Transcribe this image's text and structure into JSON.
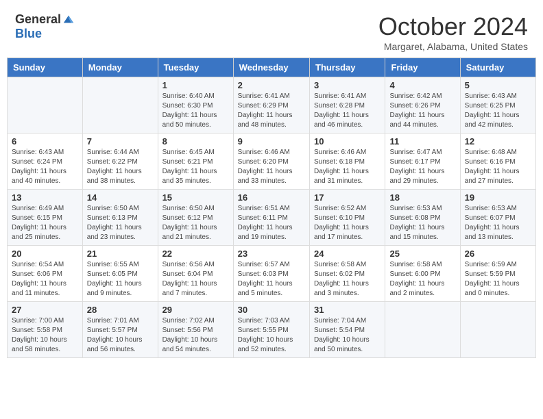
{
  "header": {
    "logo_general": "General",
    "logo_blue": "Blue",
    "title": "October 2024",
    "location": "Margaret, Alabama, United States"
  },
  "days_of_week": [
    "Sunday",
    "Monday",
    "Tuesday",
    "Wednesday",
    "Thursday",
    "Friday",
    "Saturday"
  ],
  "weeks": [
    [
      {
        "day": "",
        "info": ""
      },
      {
        "day": "",
        "info": ""
      },
      {
        "day": "1",
        "info": "Sunrise: 6:40 AM\nSunset: 6:30 PM\nDaylight: 11 hours and 50 minutes."
      },
      {
        "day": "2",
        "info": "Sunrise: 6:41 AM\nSunset: 6:29 PM\nDaylight: 11 hours and 48 minutes."
      },
      {
        "day": "3",
        "info": "Sunrise: 6:41 AM\nSunset: 6:28 PM\nDaylight: 11 hours and 46 minutes."
      },
      {
        "day": "4",
        "info": "Sunrise: 6:42 AM\nSunset: 6:26 PM\nDaylight: 11 hours and 44 minutes."
      },
      {
        "day": "5",
        "info": "Sunrise: 6:43 AM\nSunset: 6:25 PM\nDaylight: 11 hours and 42 minutes."
      }
    ],
    [
      {
        "day": "6",
        "info": "Sunrise: 6:43 AM\nSunset: 6:24 PM\nDaylight: 11 hours and 40 minutes."
      },
      {
        "day": "7",
        "info": "Sunrise: 6:44 AM\nSunset: 6:22 PM\nDaylight: 11 hours and 38 minutes."
      },
      {
        "day": "8",
        "info": "Sunrise: 6:45 AM\nSunset: 6:21 PM\nDaylight: 11 hours and 35 minutes."
      },
      {
        "day": "9",
        "info": "Sunrise: 6:46 AM\nSunset: 6:20 PM\nDaylight: 11 hours and 33 minutes."
      },
      {
        "day": "10",
        "info": "Sunrise: 6:46 AM\nSunset: 6:18 PM\nDaylight: 11 hours and 31 minutes."
      },
      {
        "day": "11",
        "info": "Sunrise: 6:47 AM\nSunset: 6:17 PM\nDaylight: 11 hours and 29 minutes."
      },
      {
        "day": "12",
        "info": "Sunrise: 6:48 AM\nSunset: 6:16 PM\nDaylight: 11 hours and 27 minutes."
      }
    ],
    [
      {
        "day": "13",
        "info": "Sunrise: 6:49 AM\nSunset: 6:15 PM\nDaylight: 11 hours and 25 minutes."
      },
      {
        "day": "14",
        "info": "Sunrise: 6:50 AM\nSunset: 6:13 PM\nDaylight: 11 hours and 23 minutes."
      },
      {
        "day": "15",
        "info": "Sunrise: 6:50 AM\nSunset: 6:12 PM\nDaylight: 11 hours and 21 minutes."
      },
      {
        "day": "16",
        "info": "Sunrise: 6:51 AM\nSunset: 6:11 PM\nDaylight: 11 hours and 19 minutes."
      },
      {
        "day": "17",
        "info": "Sunrise: 6:52 AM\nSunset: 6:10 PM\nDaylight: 11 hours and 17 minutes."
      },
      {
        "day": "18",
        "info": "Sunrise: 6:53 AM\nSunset: 6:08 PM\nDaylight: 11 hours and 15 minutes."
      },
      {
        "day": "19",
        "info": "Sunrise: 6:53 AM\nSunset: 6:07 PM\nDaylight: 11 hours and 13 minutes."
      }
    ],
    [
      {
        "day": "20",
        "info": "Sunrise: 6:54 AM\nSunset: 6:06 PM\nDaylight: 11 hours and 11 minutes."
      },
      {
        "day": "21",
        "info": "Sunrise: 6:55 AM\nSunset: 6:05 PM\nDaylight: 11 hours and 9 minutes."
      },
      {
        "day": "22",
        "info": "Sunrise: 6:56 AM\nSunset: 6:04 PM\nDaylight: 11 hours and 7 minutes."
      },
      {
        "day": "23",
        "info": "Sunrise: 6:57 AM\nSunset: 6:03 PM\nDaylight: 11 hours and 5 minutes."
      },
      {
        "day": "24",
        "info": "Sunrise: 6:58 AM\nSunset: 6:02 PM\nDaylight: 11 hours and 3 minutes."
      },
      {
        "day": "25",
        "info": "Sunrise: 6:58 AM\nSunset: 6:00 PM\nDaylight: 11 hours and 2 minutes."
      },
      {
        "day": "26",
        "info": "Sunrise: 6:59 AM\nSunset: 5:59 PM\nDaylight: 11 hours and 0 minutes."
      }
    ],
    [
      {
        "day": "27",
        "info": "Sunrise: 7:00 AM\nSunset: 5:58 PM\nDaylight: 10 hours and 58 minutes."
      },
      {
        "day": "28",
        "info": "Sunrise: 7:01 AM\nSunset: 5:57 PM\nDaylight: 10 hours and 56 minutes."
      },
      {
        "day": "29",
        "info": "Sunrise: 7:02 AM\nSunset: 5:56 PM\nDaylight: 10 hours and 54 minutes."
      },
      {
        "day": "30",
        "info": "Sunrise: 7:03 AM\nSunset: 5:55 PM\nDaylight: 10 hours and 52 minutes."
      },
      {
        "day": "31",
        "info": "Sunrise: 7:04 AM\nSunset: 5:54 PM\nDaylight: 10 hours and 50 minutes."
      },
      {
        "day": "",
        "info": ""
      },
      {
        "day": "",
        "info": ""
      }
    ]
  ]
}
